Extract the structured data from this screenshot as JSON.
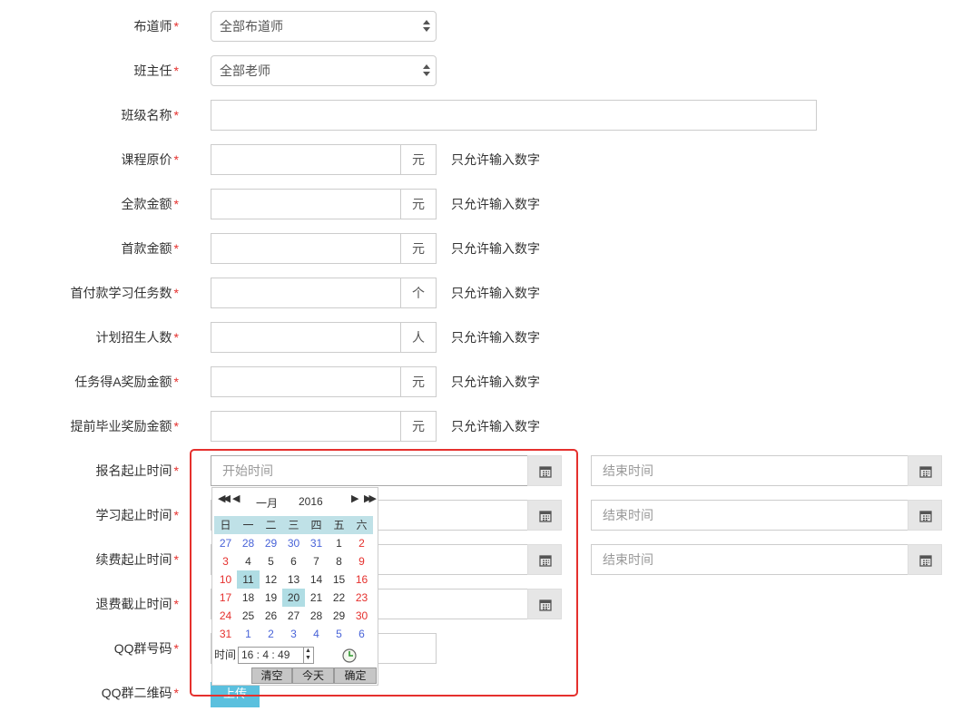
{
  "required_mark": "*",
  "fields": {
    "preacher": {
      "label": "布道师",
      "value": "全部布道师"
    },
    "head_teacher": {
      "label": "班主任",
      "value": "全部老师"
    },
    "class_name": {
      "label": "班级名称",
      "value": ""
    },
    "original_price": {
      "label": "课程原价",
      "unit": "元",
      "hint": "只允许输入数字"
    },
    "full_amount": {
      "label": "全款金额",
      "unit": "元",
      "hint": "只允许输入数字"
    },
    "first_payment": {
      "label": "首款金额",
      "unit": "元",
      "hint": "只允许输入数字"
    },
    "first_tasks": {
      "label": "首付款学习任务数",
      "unit": "个",
      "hint": "只允许输入数字"
    },
    "planned_enrollment": {
      "label": "计划招生人数",
      "unit": "人",
      "hint": "只允许输入数字"
    },
    "task_a_reward": {
      "label": "任务得A奖励金额",
      "unit": "元",
      "hint": "只允许输入数字"
    },
    "early_grad_reward": {
      "label": "提前毕业奖励金额",
      "unit": "元",
      "hint": "只允许输入数字"
    },
    "signup_period": {
      "label": "报名起止时间",
      "start_placeholder": "开始时间",
      "end_placeholder": "结束时间"
    },
    "study_period": {
      "label": "学习起止时间",
      "end_placeholder": "结束时间"
    },
    "renewal_period": {
      "label": "续费起止时间",
      "end_placeholder": "结束时间"
    },
    "refund_deadline": {
      "label": "退费截止时间"
    },
    "qq_group": {
      "label": "QQ群号码"
    },
    "qq_qrcode": {
      "label": "QQ群二维码",
      "upload_label": "上传"
    }
  },
  "calendar": {
    "month": "一月",
    "year": "2016",
    "weekdays": [
      "日",
      "一",
      "二",
      "三",
      "四",
      "五",
      "六"
    ],
    "weeks": [
      [
        "27",
        "28",
        "29",
        "30",
        "31",
        "1",
        "2"
      ],
      [
        "3",
        "4",
        "5",
        "6",
        "7",
        "8",
        "9"
      ],
      [
        "10",
        "11",
        "12",
        "13",
        "14",
        "15",
        "16"
      ],
      [
        "17",
        "18",
        "19",
        "20",
        "21",
        "22",
        "23"
      ],
      [
        "24",
        "25",
        "26",
        "27",
        "28",
        "29",
        "30"
      ],
      [
        "31",
        "1",
        "2",
        "3",
        "4",
        "5",
        "6"
      ]
    ],
    "selected_day": "11",
    "today": "20",
    "time_label": "时间",
    "time_value": "16 : 4 : 49",
    "buttons": {
      "clear": "清空",
      "today": "今天",
      "ok": "确定"
    }
  }
}
